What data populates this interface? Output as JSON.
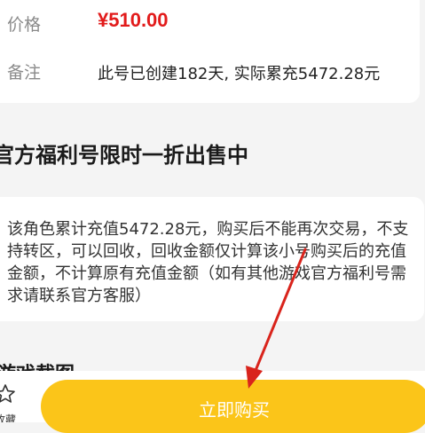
{
  "detail": {
    "price_label": "价格",
    "price_value": "¥510.00",
    "note_label": "备注",
    "note_value": "此号已创建182天, 实际累充5472.28元"
  },
  "section": {
    "title": "官方福利号限时一折出售中",
    "description": "该角色累计充值5472.28元，购买后不能再次交易，不支持转区，可以回收，回收金额仅计算该小号购买后的充值金额，不计算原有充值金额（如有其他游戏官方福利号需求请联系官方客服）"
  },
  "screenshots": {
    "title": "游戏截图"
  },
  "bottom_bar": {
    "favorite_label": "收藏",
    "favorite_icon": "star-outline-icon",
    "buy_label": "立即购买",
    "buy_color": "#fbc519"
  },
  "annotation": {
    "arrow_color": "#d9241c"
  }
}
